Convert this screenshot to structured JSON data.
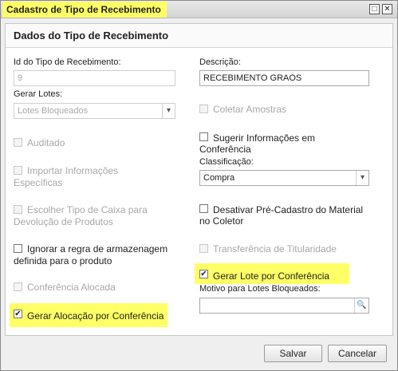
{
  "window": {
    "title": "Cadastro de Tipo de Recebimento",
    "restore_glyph": "□",
    "close_glyph": "✕"
  },
  "panel": {
    "title": "Dados do Tipo de Recebimento"
  },
  "fields": {
    "id_label": "Id do Tipo de Recebimento:",
    "id_value": "9",
    "descricao_label": "Descrição:",
    "descricao_value": "RECEBIMENTO GRAOS",
    "gerar_lotes_label": "Gerar Lotes:",
    "gerar_lotes_value": "Lotes Bloqueados",
    "classificacao_label": "Classificação:",
    "classificacao_value": "Compra",
    "motivo_label": "Motivo para Lotes Bloqueados:",
    "motivo_value": ""
  },
  "checkboxes": {
    "coletar_amostras": {
      "label": "Coletar Amostras",
      "checked": false
    },
    "auditado": {
      "label": "Auditado",
      "checked": false
    },
    "sugerir_l1": "Sugerir Informações em",
    "sugerir_l2": "Conferência",
    "importar_l1": "Importar Informações",
    "importar_l2": "Específicas",
    "escolher_l1": "Escolher Tipo de Caixa para",
    "escolher_l2": "Devolução de Produtos",
    "desativar_l1": "Desativar Pré-Cadastro do Material",
    "desativar_l2": "no Coletor",
    "ignorar_l1": "Ignorar a regra de armazenagem",
    "ignorar_l2": "definida para o produto",
    "transferencia": {
      "label": "Transferência de Titularidade",
      "checked": false
    },
    "gerar_lote": {
      "label": "Gerar Lote por Conferência",
      "checked": true
    },
    "conferencia_alocada": {
      "label": "Conferência Alocada",
      "checked": false
    },
    "gerar_alocacao": {
      "label": "Gerar Alocação por Conferência",
      "checked": true
    }
  },
  "glyphs": {
    "check": "✔",
    "dropdown": "▾",
    "search": "🔍"
  },
  "colors": {
    "highlight": "#ffff66"
  },
  "buttons": {
    "save": "Salvar",
    "cancel": "Cancelar"
  }
}
